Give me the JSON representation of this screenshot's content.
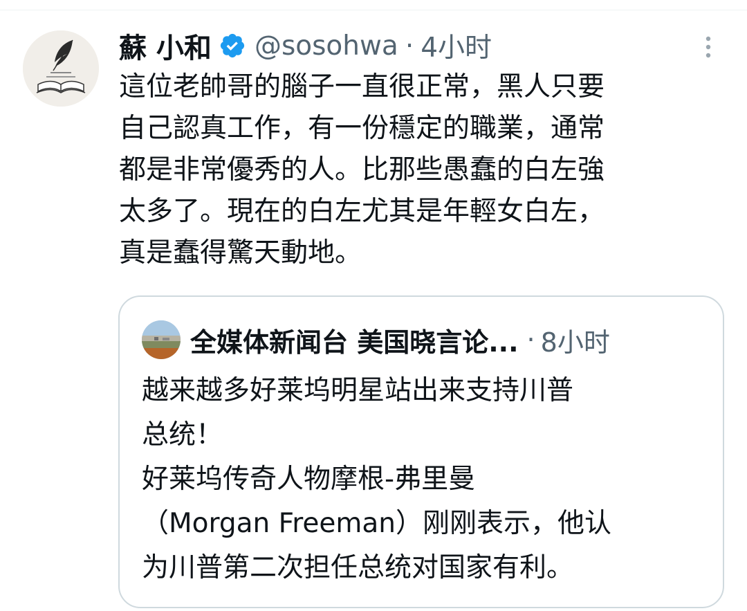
{
  "tweet": {
    "display_name": "蘇 小和",
    "handle": "@sosohwa",
    "separator": "·",
    "time": "4小时",
    "verified_icon": "verified-badge-icon",
    "more_icon": "more-options-icon",
    "text": "這位老帥哥的腦子一直很正常，黑人只要\n自己認真工作，有一份穩定的職業，通常\n都是非常優秀的人。比那些愚蠢的白左強\n太多了。現在的白左尤其是年輕女白左，\n真是蠢得驚天動地。"
  },
  "quote": {
    "display_name": "全媒体新闻台 美国晓言论...",
    "separator": "·",
    "time": "8小时",
    "text": "越来越多好莱坞明星站出来支持川普\n总统！\n好莱坞传奇人物摩根-弗里曼\n（Morgan Freeman）刚刚表示，他认\n为川普第二次担任总统对国家有利。"
  },
  "colors": {
    "verified": "#1d9bf0",
    "secondary_text": "#536471",
    "border": "#cfd9de"
  }
}
